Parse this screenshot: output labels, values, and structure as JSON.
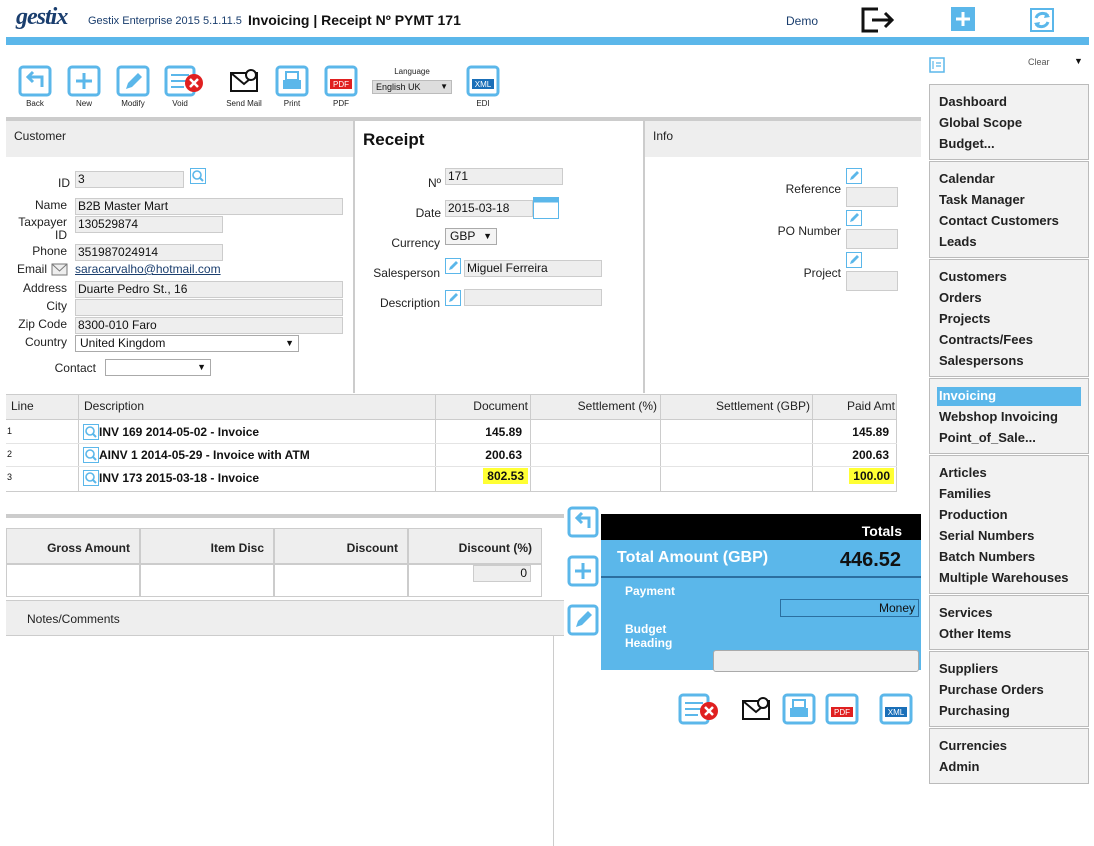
{
  "header": {
    "logo": "gestix",
    "app_version": "Gestix Enterprise 2015 5.1.11.5",
    "page_title": "Invoicing | Receipt Nº PYMT 171",
    "user": "Demo"
  },
  "toolbar": {
    "back": "Back",
    "new": "New",
    "modify": "Modify",
    "void": "Void",
    "send_mail": "Send Mail",
    "print": "Print",
    "pdf": "PDF",
    "language_label": "Language",
    "language_value": "English UK",
    "edi": "EDI"
  },
  "customer": {
    "title": "Customer",
    "id_label": "ID",
    "id_value": "3",
    "name_label": "Name",
    "name_value": "B2B Master Mart",
    "taxpayer_label": "Taxpayer ID",
    "taxpayer_value": "130529874",
    "phone_label": "Phone",
    "phone_value": "351987024914",
    "email_label": "Email",
    "email_value": "saracarvalho@hotmail.com",
    "address_label": "Address",
    "address_value": "Duarte Pedro St., 16",
    "city_label": "City",
    "city_value": "",
    "zip_label": "Zip Code",
    "zip_value": "8300-010 Faro",
    "country_label": "Country",
    "country_value": "United Kingdom",
    "contact_label": "Contact",
    "contact_value": ""
  },
  "receipt": {
    "title": "Receipt",
    "no_label": "Nº",
    "no_value": "171",
    "date_label": "Date",
    "date_value": "2015-03-18",
    "currency_label": "Currency",
    "currency_value": "GBP",
    "salesperson_label": "Salesperson",
    "salesperson_value": "Miguel Ferreira",
    "description_label": "Description",
    "description_value": ""
  },
  "info": {
    "title": "Info",
    "reference_label": "Reference",
    "po_label": "PO Number",
    "project_label": "Project"
  },
  "lines": {
    "headers": [
      "Line",
      "Description",
      "Document",
      "Settlement (%)",
      "Settlement (GBP)",
      "Paid Amt"
    ],
    "rows": [
      {
        "line": "1",
        "description": "INV 169 2014-05-02 - Invoice",
        "document": "145.89",
        "paid": "145.89"
      },
      {
        "line": "2",
        "description": "AINV 1 2014-05-29 - Invoice with ATM",
        "document": "200.63",
        "paid": "200.63"
      },
      {
        "line": "3",
        "description": "INV 173 2015-03-18 - Invoice",
        "document": "802.53",
        "paid": "100.00"
      }
    ]
  },
  "summary": {
    "gross": "Gross Amount",
    "item_disc": "Item Disc",
    "discount": "Discount",
    "discount_pct": "Discount (%)",
    "discount_pct_value": "0",
    "notes": "Notes/Comments"
  },
  "totals": {
    "title": "Totals",
    "total_label": "Total Amount (GBP)",
    "total_value": "446.52",
    "payment_label": "Payment",
    "payment_value": "Money",
    "budget_label": "Budget Heading"
  },
  "sidebar": {
    "clear": "Clear",
    "groups": [
      [
        "Dashboard",
        "Global Scope",
        "Budget..."
      ],
      [
        "Calendar",
        "Task Manager",
        "Contact Customers",
        "Leads"
      ],
      [
        "Customers",
        "Orders",
        "Projects",
        "Contracts/Fees",
        "Salespersons"
      ],
      [
        "Invoicing",
        "Webshop Invoicing",
        "Point_of_Sale..."
      ],
      [
        "Articles",
        "Families",
        "Production",
        "Serial Numbers",
        "Batch Numbers",
        "Multiple Warehouses"
      ],
      [
        "Services",
        "Other Items"
      ],
      [
        "Suppliers",
        "Purchase Orders",
        "Purchasing"
      ],
      [
        "Currencies",
        "Admin"
      ]
    ],
    "active": "Invoicing"
  },
  "colors": {
    "accent": "#5bb7ea",
    "brand": "#1a3e6e",
    "highlight": "#ffff33",
    "void_red": "#e02020"
  }
}
